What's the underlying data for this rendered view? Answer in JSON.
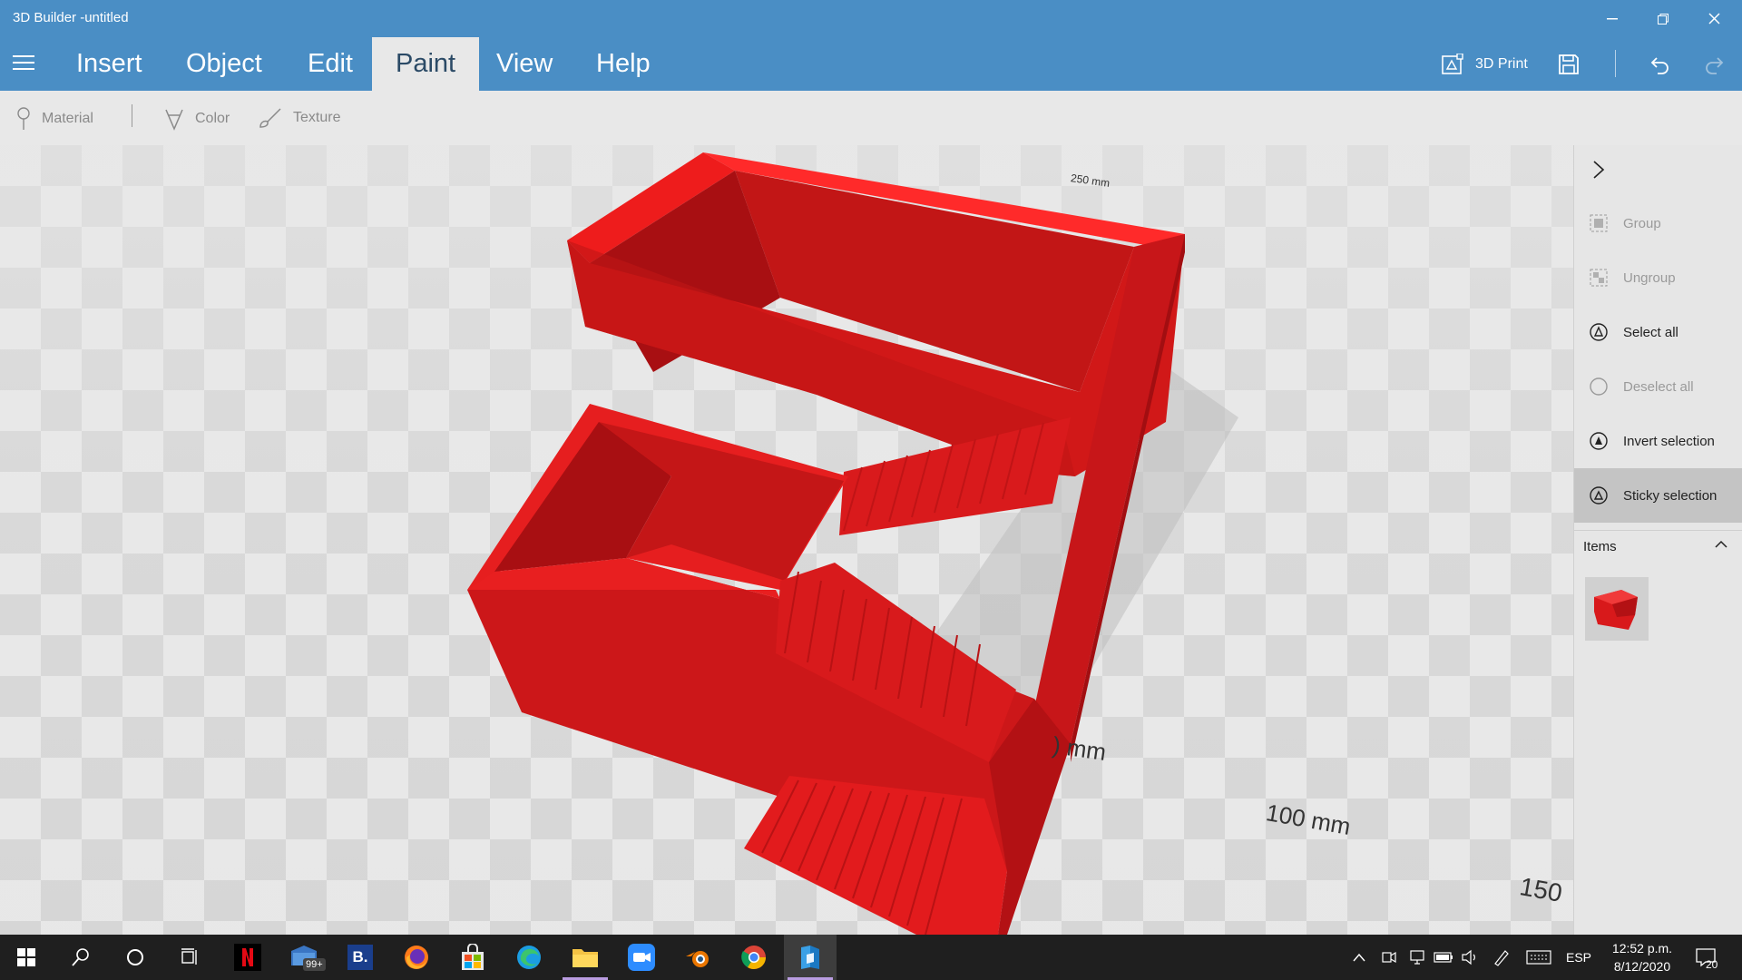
{
  "window": {
    "title": "3D Builder -untitled",
    "controls": [
      "minimize-icon",
      "restore-icon",
      "close-icon"
    ]
  },
  "menu": {
    "items": [
      {
        "label": "Insert"
      },
      {
        "label": "Object"
      },
      {
        "label": "Edit"
      },
      {
        "label": "Paint",
        "active": true
      },
      {
        "label": "View"
      },
      {
        "label": "Help"
      }
    ],
    "print_label": "3D Print"
  },
  "toolbar": {
    "material_label": "Material",
    "color_label": "Color",
    "texture_label": "Texture"
  },
  "viewport": {
    "dim_250": "250 mm",
    "dim_50": ") mm",
    "dim_100": "100 mm",
    "dim_150": "150",
    "model_color": "#e31b23"
  },
  "panel": {
    "actions": [
      {
        "label": "Group",
        "icon": "group-icon",
        "enabled": false
      },
      {
        "label": "Ungroup",
        "icon": "ungroup-icon",
        "enabled": false
      },
      {
        "label": "Select all",
        "icon": "select-all-icon",
        "enabled": true
      },
      {
        "label": "Deselect all",
        "icon": "deselect-all-icon",
        "enabled": false
      },
      {
        "label": "Invert selection",
        "icon": "invert-selection-icon",
        "enabled": true
      },
      {
        "label": "Sticky selection",
        "icon": "sticky-selection-icon",
        "enabled": true,
        "active": true
      }
    ],
    "items_label": "Items"
  },
  "taskbar": {
    "mail_badge": "99+",
    "b_label": "B.",
    "lang": "ESP",
    "time": "12:52 p.m.",
    "date": "8/12/2020",
    "notif_count": "20"
  }
}
